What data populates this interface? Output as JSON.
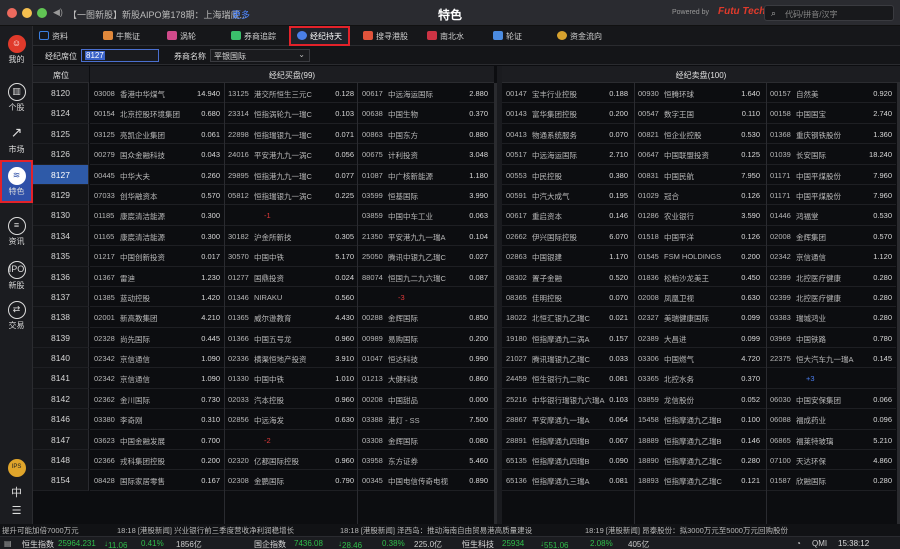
{
  "window": {
    "title": "特色",
    "powered": "Powered by",
    "brand": "Futu Tech",
    "news": "【一图新股】新股AIPO第178期：上海瑞威...",
    "more": "更多",
    "search_placeholder": "代码/拼音/汉字",
    "colors": {
      "accent": "#2f50a8",
      "highlight": "#e3222a",
      "down": "#2fbf4a",
      "up": "#e23b3b"
    }
  },
  "sidebar": {
    "items": [
      {
        "label": "我的",
        "icon": "avatar-icon"
      },
      {
        "label": "个股",
        "icon": "stock-icon"
      },
      {
        "label": "市场",
        "icon": "market-chart-icon"
      },
      {
        "label": "特色",
        "icon": "feature-icon",
        "active": true
      },
      {
        "label": "资讯",
        "icon": "news-icon"
      },
      {
        "label": "新股",
        "icon": "ipo-icon"
      },
      {
        "label": "交易",
        "icon": "trade-icon"
      }
    ],
    "bottom": [
      {
        "label": "IPS",
        "icon": "ips-icon"
      },
      {
        "label": "中",
        "icon": "lang-icon"
      },
      {
        "label": "",
        "icon": "menu-icon"
      }
    ]
  },
  "tabs": [
    {
      "label": "资料",
      "color": "#3b7fe0"
    },
    {
      "label": "牛熊证",
      "color": "#e0883b"
    },
    {
      "label": "涡轮",
      "color": "#d04a8a"
    },
    {
      "label": "券商追踪",
      "color": "#3bbf6b"
    },
    {
      "label": "经纪持天",
      "color": "#4a7ee6",
      "active": true
    },
    {
      "label": "搜寻港股",
      "color": "#e0533b"
    },
    {
      "label": "南北水",
      "color": "#cc3344"
    },
    {
      "label": "轮证",
      "color": "#4b8be0"
    },
    {
      "label": "资金流向",
      "color": "#d6a12e"
    }
  ],
  "filter": {
    "broker_label": "经纪席位",
    "broker_value": "8127",
    "firm_label": "券商名称",
    "firm_value": "平银国际"
  },
  "grid": {
    "price_header": "席位",
    "left_header": "经纪买盘(99)",
    "right_header": "经纪卖盘(100)",
    "seats": [
      "8120",
      "8124",
      "8125",
      "8126",
      "8127",
      "8129",
      "8130",
      "8134",
      "8135",
      "8136",
      "8137",
      "8138",
      "8139",
      "8140",
      "8141",
      "8142",
      "8146",
      "8147",
      "8148",
      "8154"
    ],
    "highlight_seat": "8127",
    "left_rows": [
      [
        [
          "03008",
          "香港中华煤气",
          "14.940"
        ],
        [
          "13125",
          "港交所恒生三元C",
          "0.128"
        ],
        [
          "00617",
          "中远海运国际",
          "2.880"
        ]
      ],
      [
        [
          "00154",
          "北京控股环境集团",
          "0.680"
        ],
        [
          "23314",
          "恒指涡轮九一瑞C",
          "0.103"
        ],
        [
          "00638",
          "中国生物",
          "0.370"
        ]
      ],
      [
        [
          "03125",
          "亮凯企业集团",
          "0.061"
        ],
        [
          "22898",
          "恒指瑞银九一瑞C",
          "0.071"
        ],
        [
          "00863",
          "中国东方",
          "0.880"
        ]
      ],
      [
        [
          "00279",
          "国众金融科技",
          "0.043"
        ],
        [
          "24016",
          "平安港九九一涡C",
          "0.056"
        ],
        [
          "00675",
          "计利投资",
          "3.048"
        ]
      ],
      [
        [
          "00445",
          "中华大夫",
          "0.260"
        ],
        [
          "29895",
          "恒指港九九一瑞C",
          "0.077"
        ],
        [
          "01087",
          "中广核新能源",
          "1.180"
        ]
      ],
      [
        [
          "07033",
          "创华融资本",
          "0.570"
        ],
        [
          "05812",
          "恒指瑞银九一涡C",
          "0.225"
        ],
        [
          "03599",
          "恒基国际",
          "3.990"
        ]
      ],
      [
        [
          "01185",
          "康宸清洁能源",
          "0.300"
        ],
        [
          "",
          "-1",
          ""
        ],
        [
          "03859",
          "中国中车工业",
          "0.063"
        ]
      ],
      [
        [
          "01165",
          "康宸清洁能源",
          "0.300"
        ],
        [
          "30182",
          "沪金所新技",
          "0.305"
        ],
        [
          "21350",
          "平安港九九一瑞A",
          "0.104"
        ]
      ],
      [
        [
          "01217",
          "中国创新投资",
          "0.017"
        ],
        [
          "30570",
          "中国中铁",
          "5.170"
        ],
        [
          "25050",
          "腾讯中银九乙瑞C",
          "0.027"
        ]
      ],
      [
        [
          "01367",
          "雷迪",
          "1.230"
        ],
        [
          "01277",
          "国鼎投资",
          "0.024"
        ],
        [
          "88074",
          "恒国九二九六瑞C",
          "0.087"
        ]
      ],
      [
        [
          "01385",
          "蓝动控股",
          "1.420"
        ],
        [
          "01346",
          "NIRAKU",
          "0.560"
        ],
        [
          "",
          "-3",
          ""
        ]
      ],
      [
        [
          "02001",
          "新高教集团",
          "4.210"
        ],
        [
          "01365",
          "威尔逊教育",
          "4.430"
        ],
        [
          "00288",
          "金辉国际",
          "0.850"
        ]
      ],
      [
        [
          "02328",
          "尚先国际",
          "0.445"
        ],
        [
          "01366",
          "中国五号龙",
          "0.960"
        ],
        [
          "00989",
          "易购国际",
          "0.200"
        ]
      ],
      [
        [
          "02342",
          "京信通信",
          "1.090"
        ],
        [
          "02336",
          "横渠恒地产投资",
          "3.910"
        ],
        [
          "01047",
          "恒达科技",
          "0.990"
        ]
      ],
      [
        [
          "02342",
          "京信通信",
          "1.090"
        ],
        [
          "01330",
          "中国中铁",
          "1.010"
        ],
        [
          "01213",
          "大健科技",
          "0.860"
        ]
      ],
      [
        [
          "02362",
          "金川国际",
          "0.730"
        ],
        [
          "02033",
          "汽本控股",
          "0.960"
        ],
        [
          "00208",
          "中国甜品",
          "0.000"
        ]
      ],
      [
        [
          "03380",
          "李奇刚",
          "0.310"
        ],
        [
          "02856",
          "中远海发",
          "0.630"
        ],
        [
          "03388",
          "港灯 - SS",
          "7.500"
        ]
      ],
      [
        [
          "03623",
          "中国金融发展",
          "0.700"
        ],
        [
          "",
          "-2",
          ""
        ],
        [
          "03308",
          "金辉国际",
          "0.080"
        ]
      ],
      [
        [
          "02366",
          "戎科集团控股",
          "0.200"
        ],
        [
          "02320",
          "亿都国际控股",
          "0.960"
        ],
        [
          "03958",
          "东方证券",
          "5.460"
        ]
      ],
      [
        [
          "08428",
          "国际家居零售",
          "0.167"
        ],
        [
          "02308",
          "金鹏国际",
          "0.790"
        ],
        [
          "00345",
          "中国电信传奇电视",
          "0.890"
        ]
      ]
    ],
    "right_rows": [
      [
        [
          "00147",
          "宝丰行业控股",
          "0.188"
        ],
        [
          "00930",
          "恒腾环球",
          "1.640"
        ],
        [
          "00157",
          "自然美",
          "0.920"
        ]
      ],
      [
        [
          "00143",
          "富华集团控股",
          "0.200"
        ],
        [
          "00547",
          "数字王国",
          "0.110"
        ],
        [
          "00158",
          "中国国宝",
          "2.740"
        ]
      ],
      [
        [
          "00413",
          "物通系统服务",
          "0.070"
        ],
        [
          "00821",
          "恒企业控股",
          "0.530"
        ],
        [
          "01368",
          "重庆钢铁股份",
          "1.360"
        ]
      ],
      [
        [
          "00517",
          "中远海运国际",
          "2.710"
        ],
        [
          "00647",
          "中国联盟投资",
          "0.125"
        ],
        [
          "01039",
          "长安国际",
          "18.240"
        ]
      ],
      [
        [
          "00553",
          "中民控股",
          "0.380"
        ],
        [
          "00831",
          "中国民航",
          "7.950"
        ],
        [
          "01171",
          "中国平煤股份",
          "7.960"
        ]
      ],
      [
        [
          "00591",
          "中汽大成气",
          "0.195"
        ],
        [
          "01029",
          "冠合",
          "0.126"
        ],
        [
          "01171",
          "中国平煤股份",
          "7.960"
        ]
      ],
      [
        [
          "00617",
          "重启资本",
          "0.146"
        ],
        [
          "01286",
          "农业银行",
          "3.590"
        ],
        [
          "01446",
          "鸿福堂",
          "0.530"
        ]
      ],
      [
        [
          "02662",
          "伊兴国际控股",
          "6.070"
        ],
        [
          "01518",
          "中国平洋",
          "0.126"
        ],
        [
          "02008",
          "金辉集团",
          "0.570"
        ]
      ],
      [
        [
          "02863",
          "中国银建",
          "1.170"
        ],
        [
          "01545",
          "FSM HOLDINGS",
          "0.200"
        ],
        [
          "02342",
          "京信通信",
          "1.120"
        ]
      ],
      [
        [
          "08302",
          "置子金融",
          "0.520"
        ],
        [
          "01836",
          "松柏沙龙美王",
          "0.450"
        ],
        [
          "02399",
          "北控医疗健康",
          "0.280"
        ]
      ],
      [
        [
          "08365",
          "佳明控股",
          "0.070"
        ],
        [
          "02008",
          "凤凰卫视",
          "0.630"
        ],
        [
          "02399",
          "北控医疗健康",
          "0.280"
        ]
      ],
      [
        [
          "18022",
          "北恒汇银九乙瑞C",
          "0.021"
        ],
        [
          "02327",
          "美瑞健康国际",
          "0.099"
        ],
        [
          "03383",
          "瑞城鸿业",
          "0.280"
        ]
      ],
      [
        [
          "19180",
          "恒指摩通九二涡A",
          "0.157"
        ],
        [
          "02389",
          "大昌进",
          "0.099"
        ],
        [
          "03969",
          "中国铁路",
          "0.780"
        ]
      ],
      [
        [
          "21027",
          "腾讯瑞银九乙瑞C",
          "0.033"
        ],
        [
          "03306",
          "中国燃气",
          "4.720"
        ],
        [
          "22375",
          "恒大汽车九一瑞A",
          "0.145"
        ]
      ],
      [
        [
          "24459",
          "恒生银行九二购C",
          "0.081"
        ],
        [
          "03365",
          "北控水务",
          "0.370"
        ],
        [
          "",
          "+3",
          ""
        ]
      ],
      [
        [
          "25216",
          "中华银行瑞银九六瑞A",
          "0.103"
        ],
        [
          "03859",
          "龙信股份",
          "0.052"
        ],
        [
          "06030",
          "中国安保集团",
          "0.066"
        ]
      ],
      [
        [
          "28867",
          "平安摩通九一瑞A",
          "0.064"
        ],
        [
          "15458",
          "恒指摩通九乙瑞B",
          "0.100"
        ],
        [
          "06088",
          "福成药业",
          "0.096"
        ]
      ],
      [
        [
          "28891",
          "恒指摩通九四瑞B",
          "0.067"
        ],
        [
          "18889",
          "恒指摩通九乙瑞B",
          "0.146"
        ],
        [
          "06865",
          "福莱特玻璃",
          "5.210"
        ]
      ],
      [
        [
          "65135",
          "恒指摩通九四瑞B",
          "0.090"
        ],
        [
          "18890",
          "恒指摩通九乙瑞C",
          "0.280"
        ],
        [
          "07100",
          "天达环保",
          "4.860"
        ]
      ],
      [
        [
          "65136",
          "恒指摩通九三瑞A",
          "0.081"
        ],
        [
          "18893",
          "恒指摩通九乙瑞C",
          "0.121"
        ],
        [
          "01587",
          "欣融国际",
          "0.280"
        ]
      ]
    ]
  },
  "ticker": [
    "提升可能加倍7000万元",
    "18:18 [港股新闻] 兴业银行前三季度营收净利润稳增长",
    "18:18 [港股新闻] 泽西岛：推动海南自由贸易港高质量建设",
    "18:19 [港股新闻] 昂泰股份：拟3000万元至5000万元回购股份"
  ],
  "status": {
    "hsi_label": "恒生指数",
    "hsi_value": "25964.231",
    "hsi_chg": "11.06",
    "hsi_pct": "0.41%",
    "hsi_vol": "1856亿",
    "hscei_label": "国企指数",
    "hscei_value": "7436.08",
    "hscei_chg": "28.46",
    "hscei_pct": "0.38%",
    "hscei_vol": "225.0亿",
    "sh_label": "恒生科技",
    "sh_value": "25934",
    "sh_chg": "551.06",
    "sh_pct": "2.08%",
    "sh_vol": "405亿",
    "qmi": "QMI",
    "time": "15:38:12"
  }
}
